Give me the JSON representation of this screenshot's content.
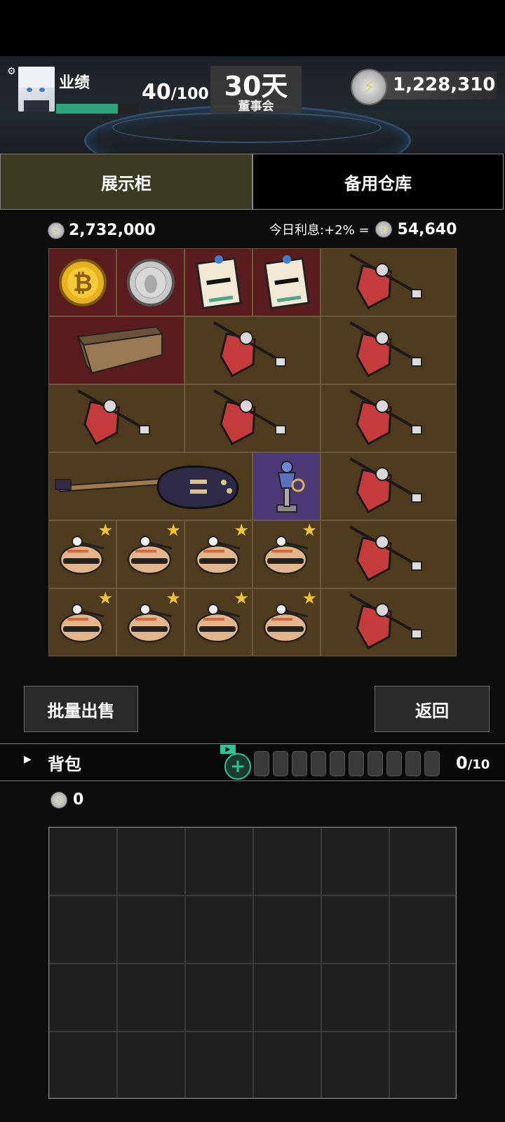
{
  "header": {
    "perf_label": "业绩",
    "perf_current": "40",
    "perf_max": "/100",
    "perf_progress": 0.75,
    "days": "30天",
    "days_sub": "董事会",
    "coins": "1,228,310"
  },
  "tabs": [
    "展示柜",
    "备用仓库"
  ],
  "showcase": {
    "total_value": "2,732,000",
    "interest_label": "今日利息:+2% =",
    "interest_value": "54,640"
  },
  "buttons": {
    "bulk_sell": "批量出售",
    "back": "返回"
  },
  "backpack": {
    "title": "背包",
    "count": "0",
    "max": "/10",
    "value": "0"
  },
  "items": [
    {
      "name": "bitcoin-coin",
      "icon": "coin-gold"
    },
    {
      "name": "silver-coin",
      "icon": "coin-silver"
    },
    {
      "name": "congratulation-card",
      "icon": "card"
    },
    {
      "name": "congratulation-card",
      "icon": "card"
    },
    {
      "name": "red-gem-pin",
      "icon": "gem"
    },
    {
      "name": "wooden-box",
      "icon": "box"
    },
    {
      "name": "electric-guitar",
      "icon": "guitar"
    },
    {
      "name": "figurine-statue",
      "icon": "statue"
    },
    {
      "name": "bread-figure",
      "icon": "bread",
      "starred": true
    }
  ]
}
